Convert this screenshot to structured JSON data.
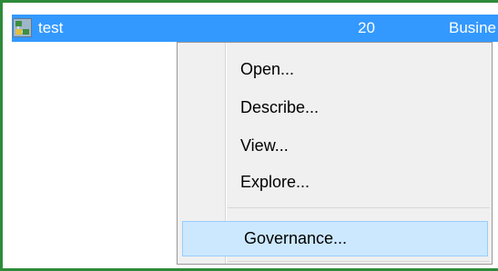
{
  "row": {
    "icon": "table-icon",
    "name": "test",
    "count": "20",
    "type_partial": "Busine"
  },
  "context_menu": {
    "items": [
      {
        "label": "Open..."
      },
      {
        "label": "Describe..."
      },
      {
        "label": "View..."
      },
      {
        "label": "Explore..."
      },
      {
        "label": "Governance..."
      }
    ],
    "hovered_item": "Governance..."
  },
  "colors": {
    "frame_border": "#2e8b3a",
    "selection": "#3399ff",
    "menu_background": "#f0f0f0",
    "menu_hover": "#cce8ff",
    "menu_hover_border": "#99ccff"
  }
}
